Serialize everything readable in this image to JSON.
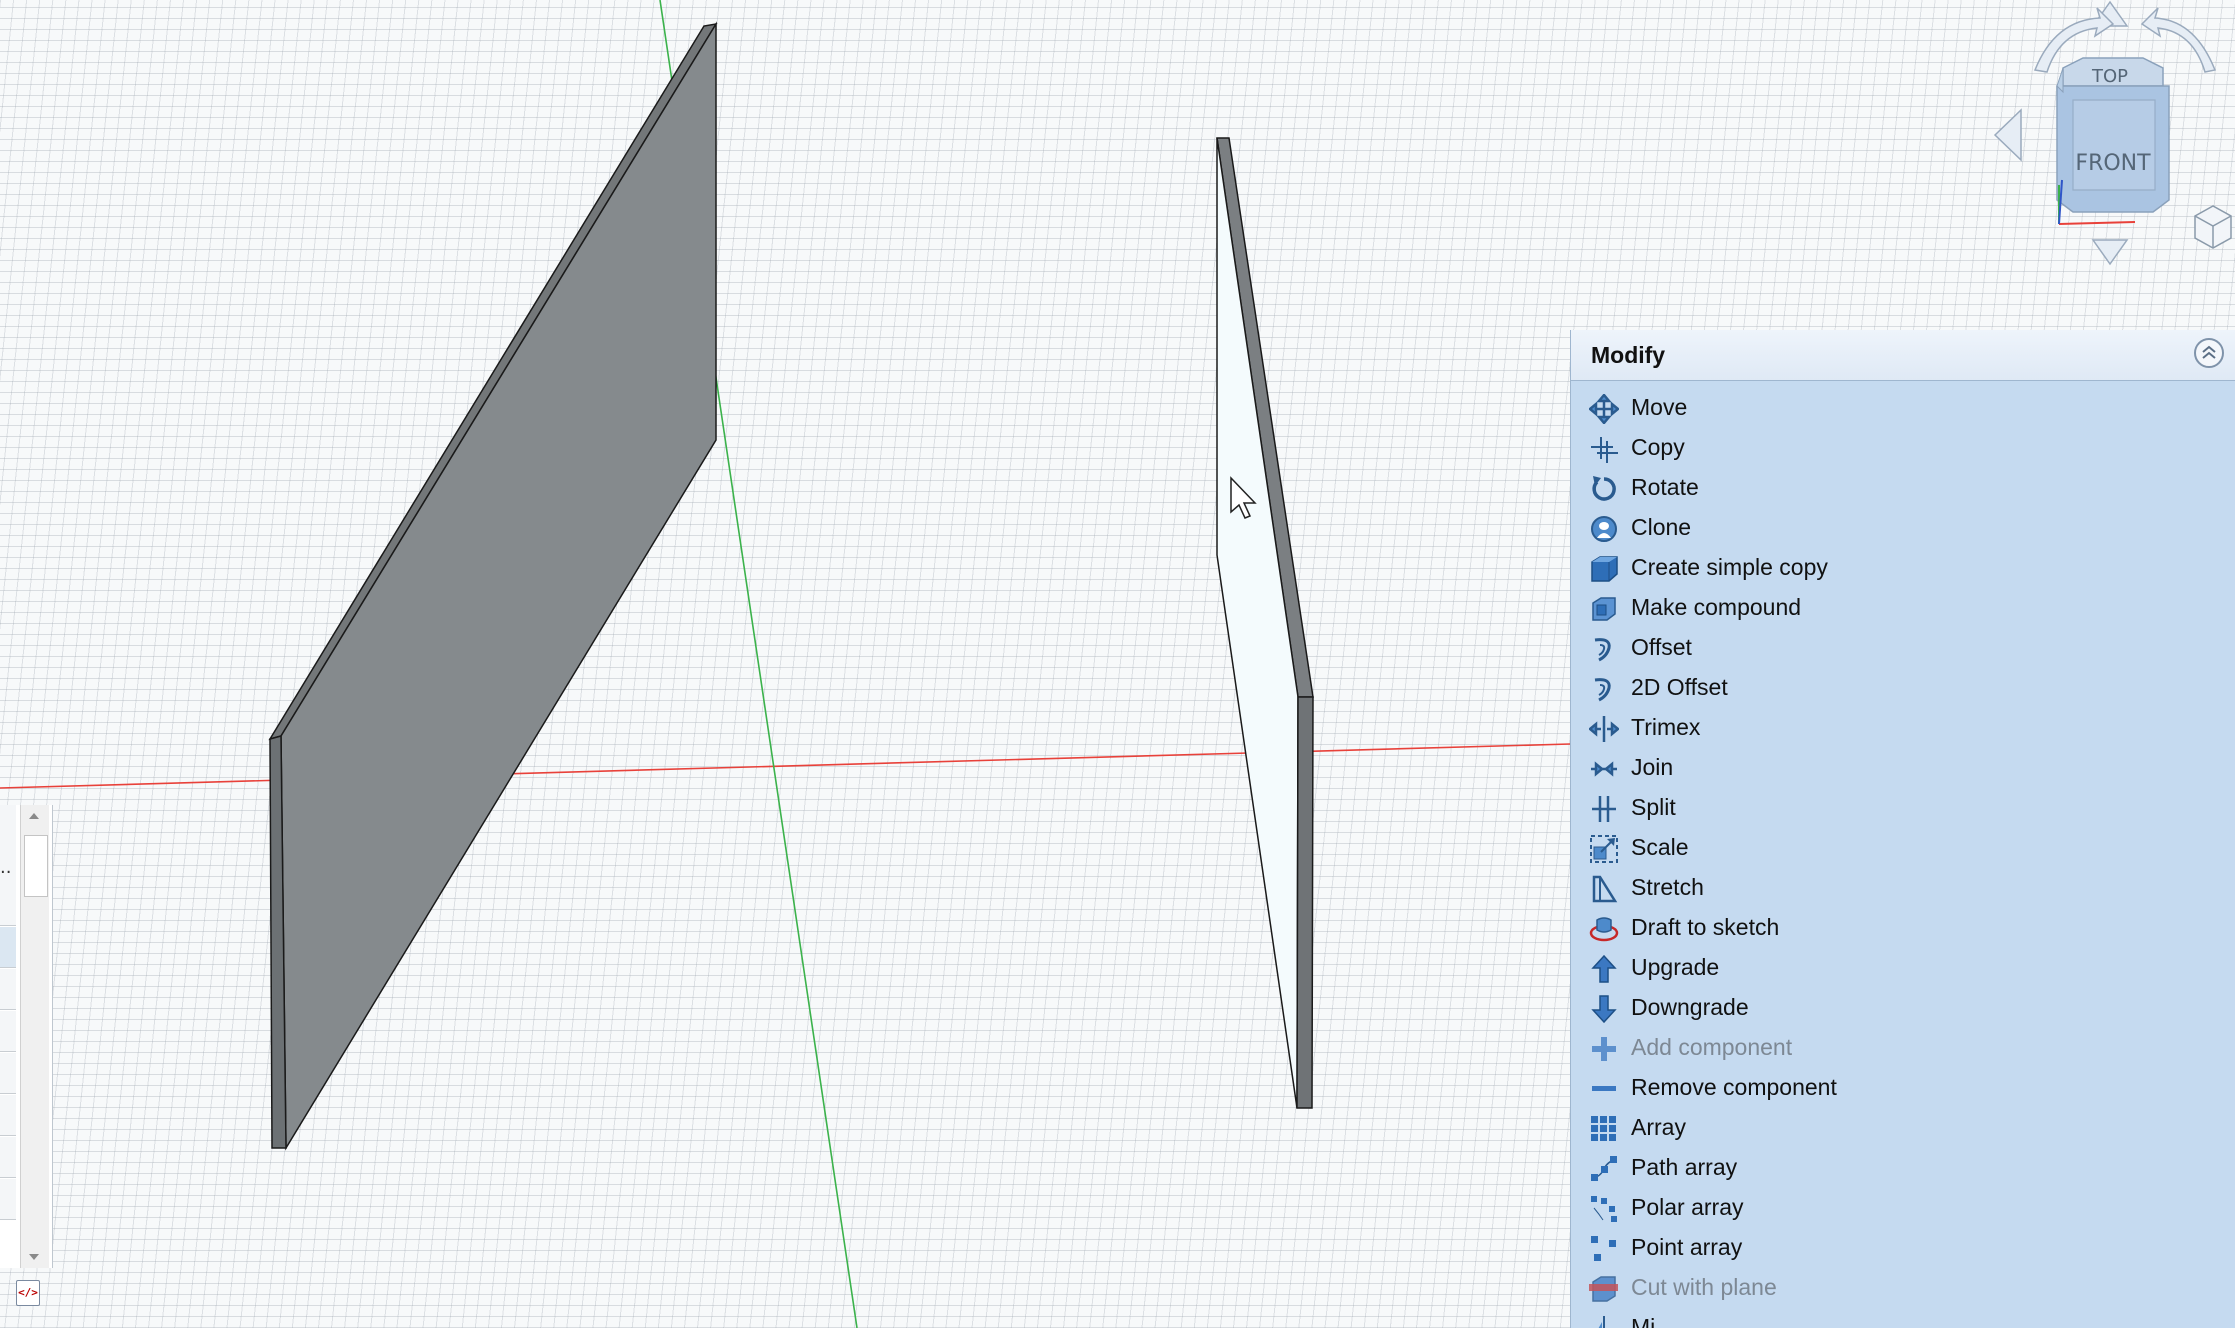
{
  "navcube": {
    "top_label": "TOP",
    "front_label": "FRONT"
  },
  "modify_panel": {
    "title": "Modify",
    "tools": [
      {
        "label": "Move",
        "icon": "move-icon",
        "enabled": true
      },
      {
        "label": "Copy",
        "icon": "copy-icon",
        "enabled": true
      },
      {
        "label": "Rotate",
        "icon": "rotate-icon",
        "enabled": true
      },
      {
        "label": "Clone",
        "icon": "clone-icon",
        "enabled": true
      },
      {
        "label": "Create simple copy",
        "icon": "simple-copy-icon",
        "enabled": true
      },
      {
        "label": "Make compound",
        "icon": "compound-icon",
        "enabled": true
      },
      {
        "label": "Offset",
        "icon": "offset-icon",
        "enabled": true
      },
      {
        "label": "2D Offset",
        "icon": "offset-2d-icon",
        "enabled": true
      },
      {
        "label": "Trimex",
        "icon": "trimex-icon",
        "enabled": true
      },
      {
        "label": "Join",
        "icon": "join-icon",
        "enabled": true
      },
      {
        "label": "Split",
        "icon": "split-icon",
        "enabled": true
      },
      {
        "label": "Scale",
        "icon": "scale-icon",
        "enabled": true
      },
      {
        "label": "Stretch",
        "icon": "stretch-icon",
        "enabled": true
      },
      {
        "label": "Draft to sketch",
        "icon": "draft-to-sketch-icon",
        "enabled": true
      },
      {
        "label": "Upgrade",
        "icon": "upgrade-arrow-icon",
        "enabled": true
      },
      {
        "label": "Downgrade",
        "icon": "downgrade-arrow-icon",
        "enabled": true
      },
      {
        "label": "Add component",
        "icon": "plus-icon",
        "enabled": false
      },
      {
        "label": "Remove component",
        "icon": "minus-icon",
        "enabled": true
      },
      {
        "label": "Array",
        "icon": "array-grid-icon",
        "enabled": true
      },
      {
        "label": "Path array",
        "icon": "path-array-icon",
        "enabled": true
      },
      {
        "label": "Polar array",
        "icon": "polar-array-icon",
        "enabled": true
      },
      {
        "label": "Point array",
        "icon": "point-array-icon",
        "enabled": true
      },
      {
        "label": "Cut with plane",
        "icon": "cut-plane-icon",
        "enabled": false
      },
      {
        "label": "Mi...",
        "icon": "mirror-icon",
        "enabled": true
      }
    ]
  },
  "left_panel": {
    "ellipsis": ".."
  },
  "colors": {
    "panel_bg": "#c5daf0",
    "solid_face": "#858a8d",
    "solid_edge": "#6c7174",
    "x_axis": "#e8413a",
    "y_axis": "#3bb24b",
    "nav_cube": "#aac4e2"
  }
}
